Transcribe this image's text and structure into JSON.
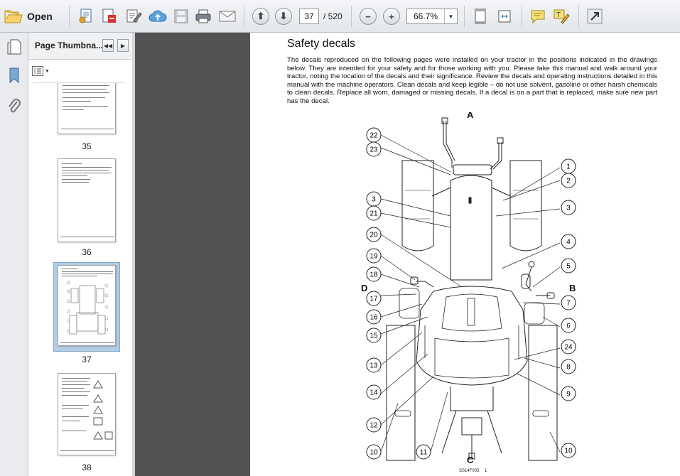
{
  "toolbar": {
    "open_label": "Open",
    "current_page": "37",
    "page_total": "/ 520",
    "zoom_value": "66.7%"
  },
  "thumbnails": {
    "title": "Page Thumbna...",
    "pages": [
      {
        "label": "35"
      },
      {
        "label": "36"
      },
      {
        "label": "37",
        "selected": true
      },
      {
        "label": "38"
      }
    ]
  },
  "document": {
    "heading": "Safety decals",
    "body": "The decals reproduced on the following pages were installed on your tractor in the positions indicated in the drawings below.  They are intended for your safety and for those working with you.  Please take this manual and walk around your tractor, noting the location of the decals and their significance.  Review the decals and operating instructions detailed in this manual with the machine operators.  Clean decals and keep legible – do not use solvent, gasoline or other harsh chemicals to clean decals.  Replace all worn, damaged or missing decals.  If a decal is on a part that is replaced, make sure new part has the decal.",
    "diagram": {
      "view_letters": {
        "front": "A",
        "right": "B",
        "rear": "C",
        "left": "D"
      },
      "callouts_left": [
        "22",
        "23",
        "3",
        "21",
        "20",
        "19",
        "18",
        "17",
        "16",
        "15",
        "13",
        "14",
        "12",
        "10"
      ],
      "callouts_right": [
        "1",
        "2",
        "3",
        "4",
        "5",
        "7",
        "6",
        "24",
        "8",
        "9",
        "10"
      ],
      "callouts_bottom": [
        "11"
      ],
      "figure_code": "SS14F005",
      "figure_number": "1"
    }
  },
  "colors": {
    "toolbar_bg": "#e8eaed",
    "doc_bg": "#535353",
    "selection": "#b3cde3"
  }
}
